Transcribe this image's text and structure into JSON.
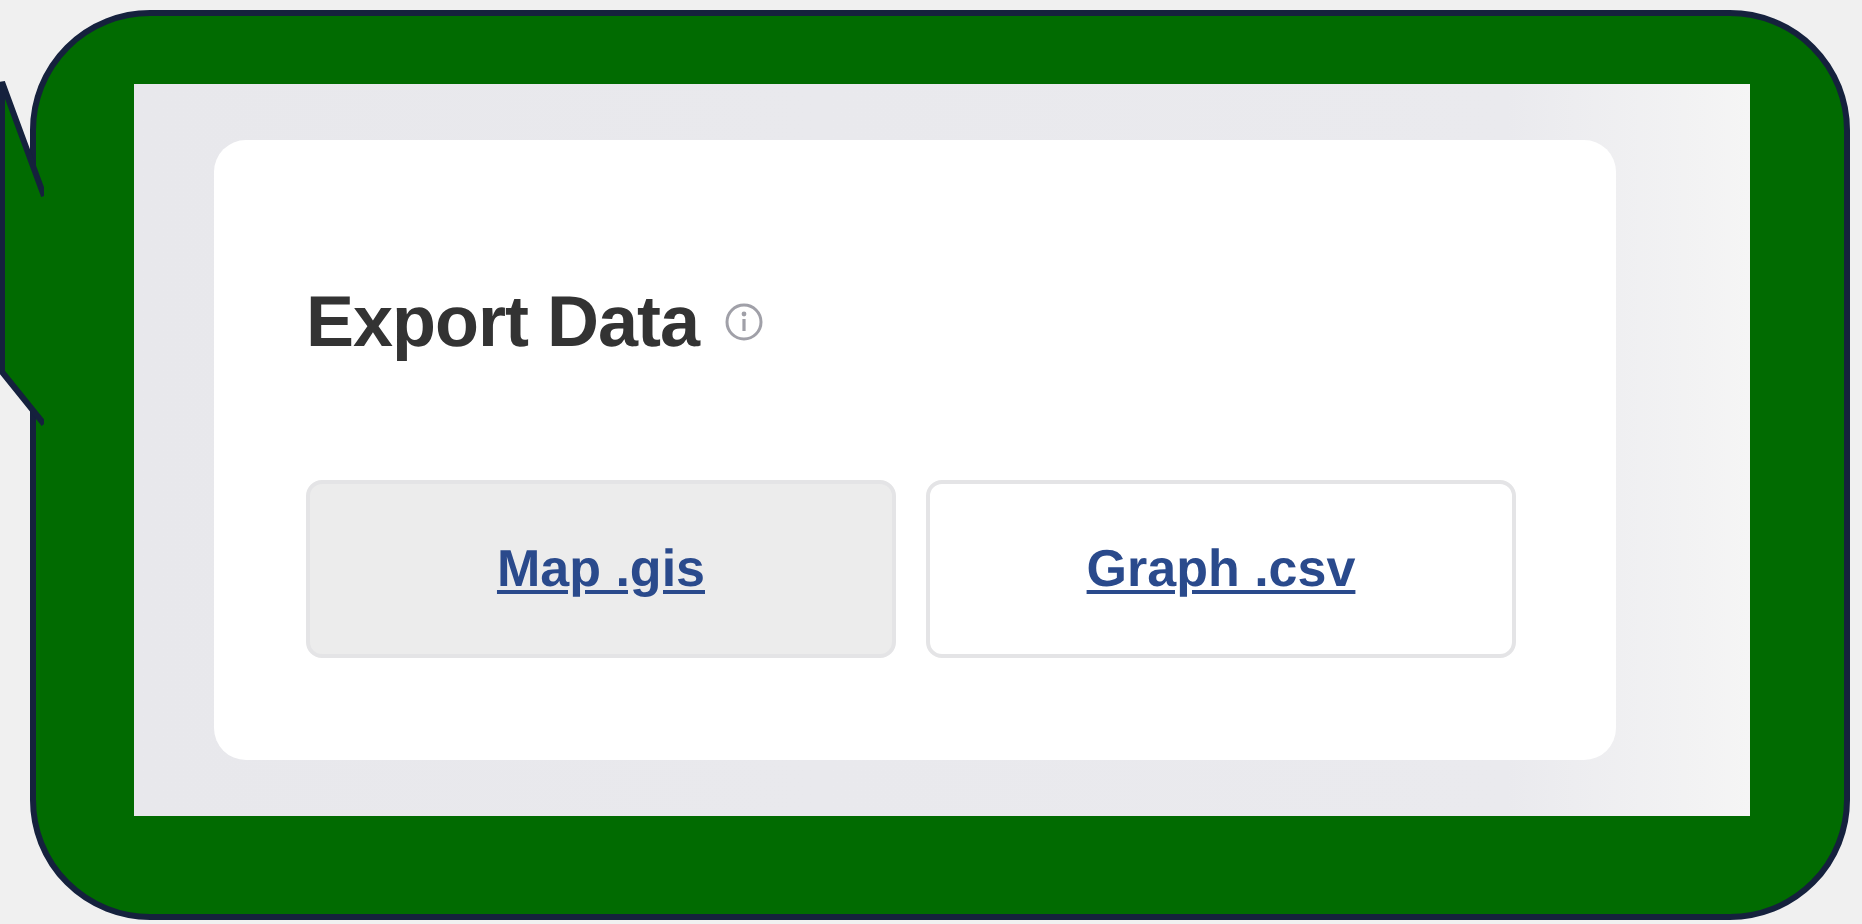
{
  "panel": {
    "title": "Export Data",
    "buttons": [
      {
        "label": "Map .gis",
        "selected": true
      },
      {
        "label": "Graph .csv",
        "selected": false
      }
    ]
  }
}
